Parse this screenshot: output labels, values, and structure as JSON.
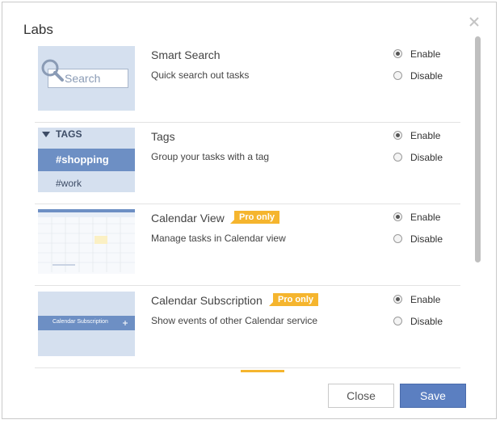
{
  "dialog": {
    "title": "Labs",
    "close_icon": "close-icon"
  },
  "features": [
    {
      "name": "Smart Search",
      "description": "Quick search out tasks",
      "pro": "",
      "enable_label": "Enable",
      "disable_label": "Disable",
      "enabled": true,
      "thumb": {
        "placeholder": "Search"
      }
    },
    {
      "name": "Tags",
      "description": "Group your tasks with a tag",
      "pro": "",
      "enable_label": "Enable",
      "disable_label": "Disable",
      "enabled": true,
      "thumb": {
        "header": "TAGS",
        "selected": "#shopping",
        "item": "#work"
      }
    },
    {
      "name": "Calendar View",
      "description": "Manage tasks in Calendar view",
      "pro": "Pro only",
      "enable_label": "Enable",
      "disable_label": "Disable",
      "enabled": true
    },
    {
      "name": "Calendar Subscription",
      "description": "Show events of other Calendar service",
      "pro": "Pro only",
      "enable_label": "Enable",
      "disable_label": "Disable",
      "enabled": true,
      "thumb": {
        "bar_label": "Calendar Subscription"
      }
    }
  ],
  "footer": {
    "close_label": "Close",
    "save_label": "Save"
  },
  "colors": {
    "accent": "#5b7fc1",
    "badge": "#f5b52e",
    "thumb_bg": "#d5e0ef"
  }
}
